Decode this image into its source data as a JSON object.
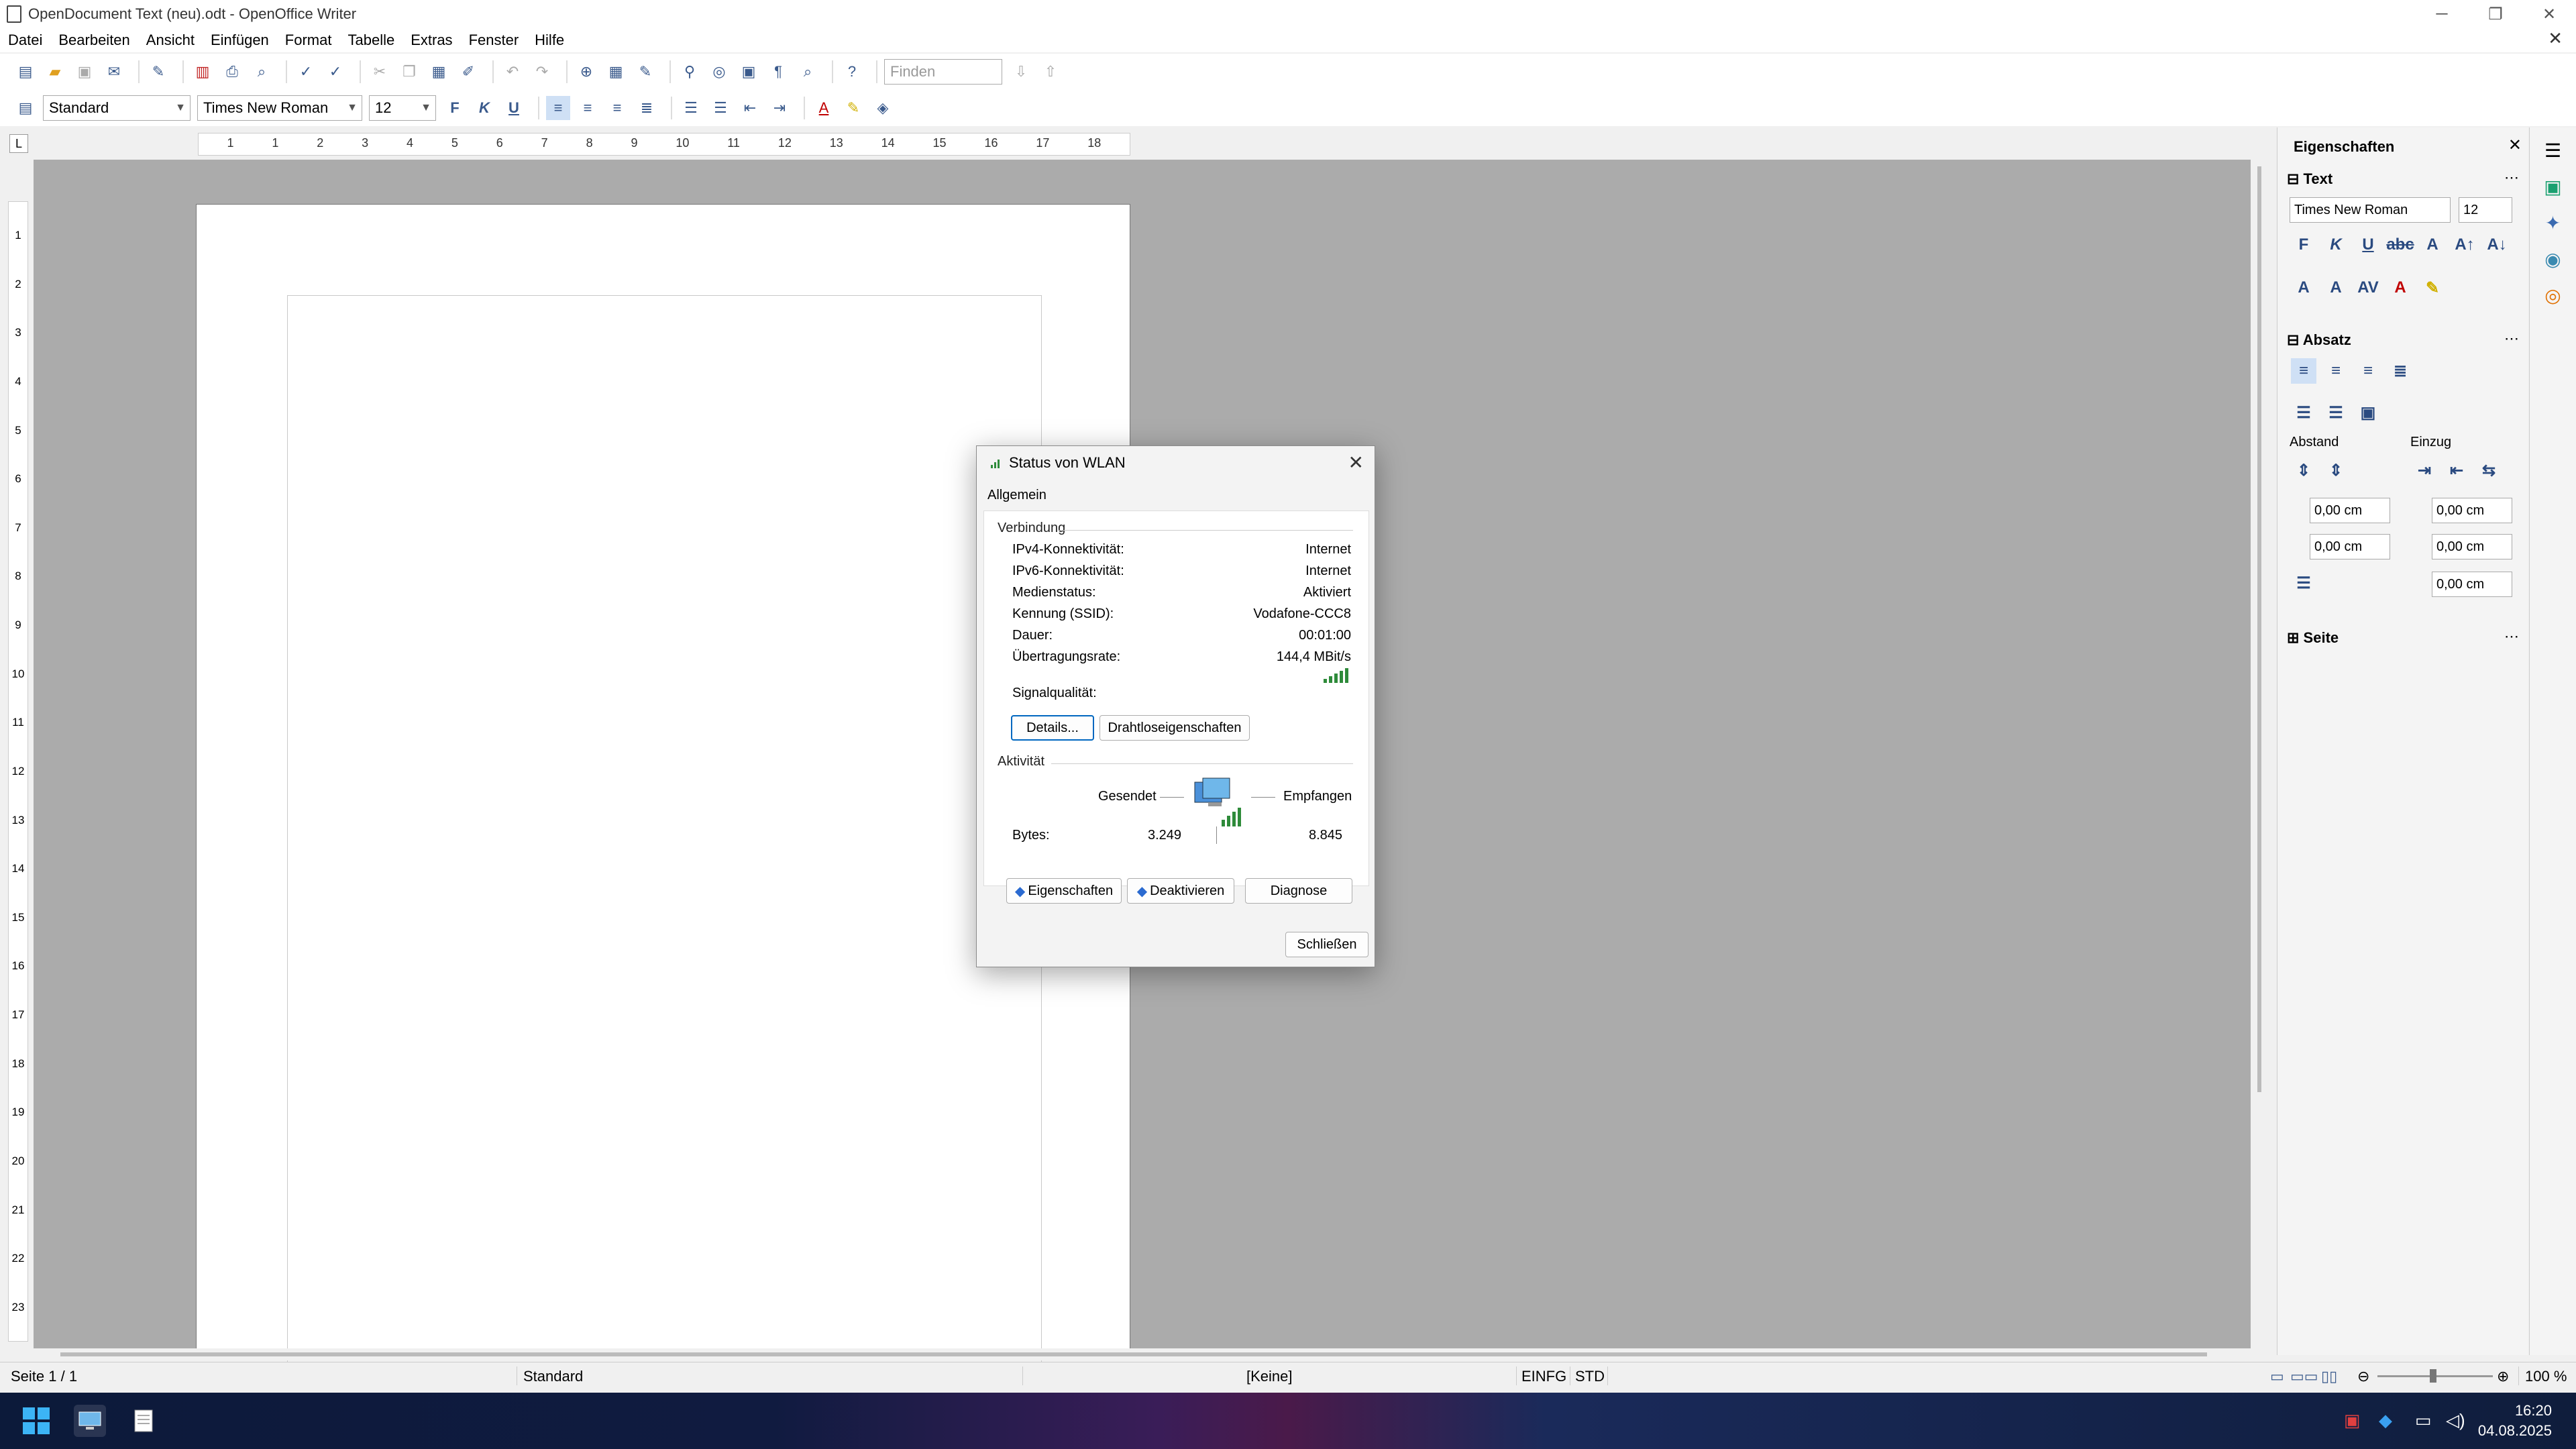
{
  "window": {
    "title": "OpenDocument Text (neu).odt - OpenOffice Writer",
    "min_glyph": "─",
    "max_glyph": "❐",
    "close_glyph": "✕",
    "doc_close_glyph": "✕"
  },
  "menu": {
    "items": [
      "Datei",
      "Bearbeiten",
      "Ansicht",
      "Einfügen",
      "Format",
      "Tabelle",
      "Extras",
      "Fenster",
      "Hilfe"
    ]
  },
  "toolbar1": {
    "find_placeholder": "Finden"
  },
  "toolbar2": {
    "style_value": "Standard",
    "font_value": "Times New Roman",
    "size_value": "12",
    "bold_label": "F",
    "italic_label": "K",
    "underline_label": "U"
  },
  "ruler": {
    "h_marks": [
      "1",
      "1",
      "2",
      "3",
      "4",
      "5",
      "6",
      "7",
      "8",
      "9",
      "10",
      "11",
      "12",
      "13",
      "14",
      "15",
      "16",
      "17",
      "18"
    ],
    "v_marks": [
      "1",
      "2",
      "3",
      "4",
      "5",
      "6",
      "7",
      "8",
      "9",
      "10",
      "11",
      "12",
      "13",
      "14",
      "15",
      "16",
      "17",
      "18",
      "19",
      "20",
      "21",
      "22",
      "23"
    ],
    "corner_glyph": "L"
  },
  "sidebar": {
    "title": "Eigenschaften",
    "text_section": "Text",
    "font_value": "Times New Roman",
    "size_value": "12",
    "paragraph_section": "Absatz",
    "abstand_label": "Abstand",
    "einzug_label": "Einzug",
    "spacing_values": [
      "0,00 cm",
      "0,00 cm",
      "0,00 cm",
      "0,00 cm",
      "0,00 cm"
    ],
    "page_section": "Seite",
    "more_glyph": "⋯",
    "close_glyph": "✕",
    "bold_label": "F",
    "italic_label": "K",
    "underline_label": "U"
  },
  "statusbar": {
    "page": "Seite 1 / 1",
    "style": "Standard",
    "language": "[Keine]",
    "insert_mode": "EINFG",
    "selection_mode": "STD",
    "zoom": "100 %"
  },
  "taskbar": {
    "time": "16:20",
    "date": "04.08.2025"
  },
  "dialog": {
    "title": "Status von WLAN",
    "tab": "Allgemein",
    "connection_group": "Verbindung",
    "rows": [
      {
        "label": "IPv4-Konnektivität:",
        "value": "Internet"
      },
      {
        "label": "IPv6-Konnektivität:",
        "value": "Internet"
      },
      {
        "label": "Medienstatus:",
        "value": "Aktiviert"
      },
      {
        "label": "Kennung (SSID):",
        "value": "Vodafone-CCC8"
      },
      {
        "label": "Dauer:",
        "value": "00:01:00"
      },
      {
        "label": "Übertragungsrate:",
        "value": "144,4 MBit/s"
      }
    ],
    "signal_label": "Signalqualität:",
    "signal_level": 5,
    "details_button": "Details...",
    "wireless_button": "Drahtloseigenschaften",
    "activity_group": "Aktivität",
    "sent_label": "Gesendet",
    "received_label": "Empfangen",
    "bytes_label": "Bytes:",
    "bytes_sent": "3.249",
    "bytes_received": "8.845",
    "properties_button": "Eigenschaften",
    "disable_button": "Deaktivieren",
    "diagnose_button": "Diagnose",
    "close_button": "Schließen",
    "close_glyph": "✕"
  },
  "colors": {
    "accent": "#0067c0",
    "doc_background": "#ababab",
    "signal": "#2e8b3a"
  }
}
